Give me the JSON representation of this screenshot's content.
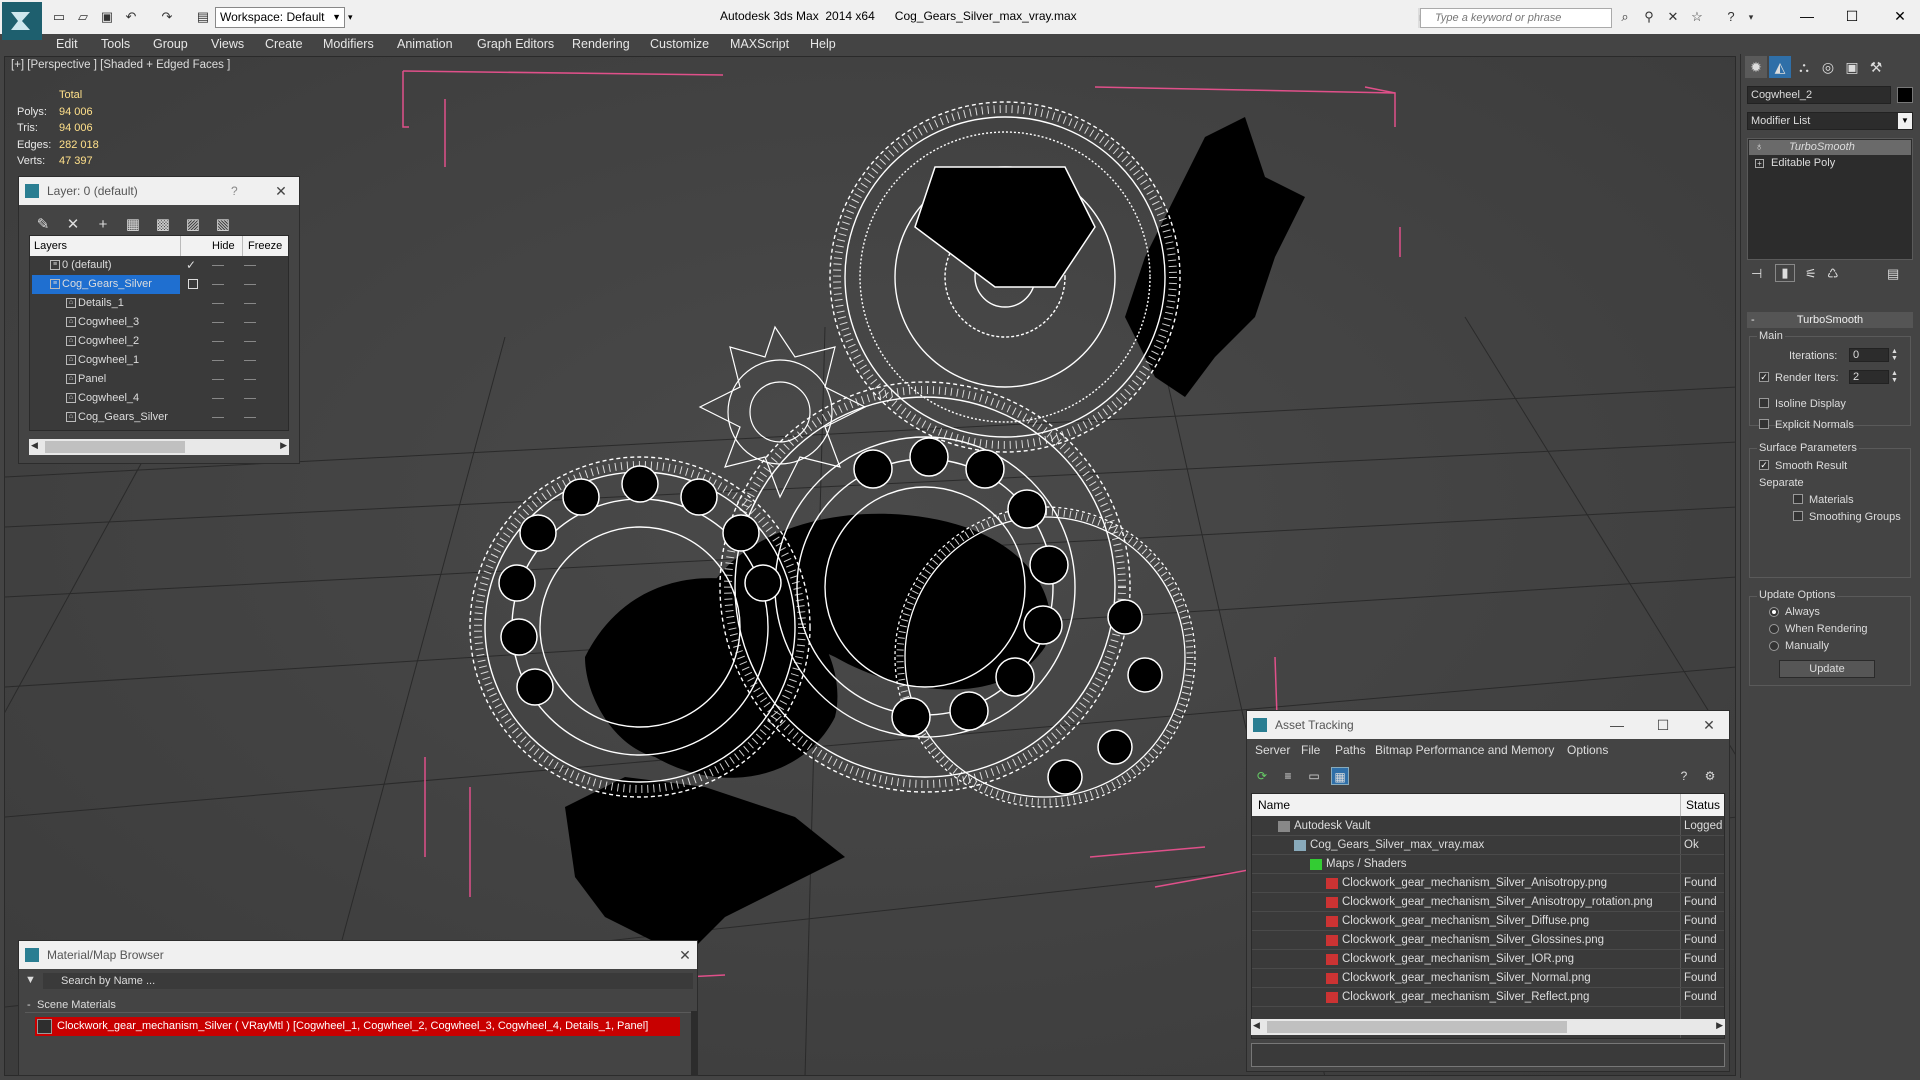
{
  "titlebar": {
    "workspace_label": "Workspace: Default",
    "app_title": "Autodesk 3ds Max  2014 x64",
    "file_title": "Cog_Gears_Silver_max_vray.max",
    "search_placeholder": "Type a keyword or phrase"
  },
  "menu": [
    "Edit",
    "Tools",
    "Group",
    "Views",
    "Create",
    "Modifiers",
    "Animation",
    "Graph Editors",
    "Rendering",
    "Customize",
    "MAXScript",
    "Help"
  ],
  "viewport": {
    "label": "[+] [Perspective ] [Shaded + Edged Faces ]",
    "stats": {
      "header": "Total",
      "rows": [
        {
          "label": "Polys:",
          "value": "94 006"
        },
        {
          "label": "Tris:",
          "value": "94 006"
        },
        {
          "label": "Edges:",
          "value": "282 018"
        },
        {
          "label": "Verts:",
          "value": "47 397"
        }
      ]
    }
  },
  "layer_panel": {
    "title": "Layer: 0 (default)",
    "help": "?",
    "columns": {
      "layers": "Layers",
      "hide": "Hide",
      "freeze": "Freeze"
    },
    "rows": [
      {
        "name": "0 (default)",
        "active": true,
        "selected": false,
        "indent": 1
      },
      {
        "name": "Cog_Gears_Silver",
        "active": false,
        "selected": true,
        "indent": 1
      },
      {
        "name": "Details_1",
        "active": false,
        "selected": false,
        "indent": 2
      },
      {
        "name": "Cogwheel_3",
        "active": false,
        "selected": false,
        "indent": 2
      },
      {
        "name": "Cogwheel_2",
        "active": false,
        "selected": false,
        "indent": 2
      },
      {
        "name": "Cogwheel_1",
        "active": false,
        "selected": false,
        "indent": 2
      },
      {
        "name": "Panel",
        "active": false,
        "selected": false,
        "indent": 2
      },
      {
        "name": "Cogwheel_4",
        "active": false,
        "selected": false,
        "indent": 2
      },
      {
        "name": "Cog_Gears_Silver",
        "active": false,
        "selected": false,
        "indent": 2
      }
    ]
  },
  "command_panel": {
    "object_name": "Cogwheel_2",
    "modifier_list": "Modifier List",
    "stack": [
      "TurboSmooth",
      "Editable Poly"
    ],
    "rollout_title": "TurboSmooth",
    "main_group": "Main",
    "iterations_label": "Iterations:",
    "iterations_value": "0",
    "render_iters_label": "Render Iters:",
    "render_iters_value": "2",
    "render_iters_checked": true,
    "isoline_label": "Isoline Display",
    "isoline_checked": false,
    "explicit_label": "Explicit Normals",
    "explicit_checked": false,
    "surface_group": "Surface Parameters",
    "smooth_result_label": "Smooth Result",
    "smooth_result_checked": true,
    "separate_label": "Separate",
    "materials_label": "Materials",
    "smoothing_groups_label": "Smoothing Groups",
    "update_group": "Update Options",
    "always_label": "Always",
    "when_rendering_label": "When Rendering",
    "manually_label": "Manually",
    "update_button": "Update"
  },
  "asset_panel": {
    "title": "Asset Tracking",
    "menu": [
      "Server",
      "File",
      "Paths",
      "Bitmap Performance and Memory",
      "Options"
    ],
    "columns": {
      "name": "Name",
      "status": "Status"
    },
    "rows": [
      {
        "name": "Autodesk Vault",
        "status": "Logged",
        "indent": 1,
        "kind": "vault"
      },
      {
        "name": "Cog_Gears_Silver_max_vray.max",
        "status": "Ok",
        "indent": 2,
        "kind": "max"
      },
      {
        "name": "Maps / Shaders",
        "status": "",
        "indent": 3,
        "kind": "folder"
      },
      {
        "name": "Clockwork_gear_mechanism_Silver_Anisotropy.png",
        "status": "Found",
        "indent": 4,
        "kind": "png"
      },
      {
        "name": "Clockwork_gear_mechanism_Silver_Anisotropy_rotation.png",
        "status": "Found",
        "indent": 4,
        "kind": "png"
      },
      {
        "name": "Clockwork_gear_mechanism_Silver_Diffuse.png",
        "status": "Found",
        "indent": 4,
        "kind": "png"
      },
      {
        "name": "Clockwork_gear_mechanism_Silver_Glossines.png",
        "status": "Found",
        "indent": 4,
        "kind": "png"
      },
      {
        "name": "Clockwork_gear_mechanism_Silver_IOR.png",
        "status": "Found",
        "indent": 4,
        "kind": "png"
      },
      {
        "name": "Clockwork_gear_mechanism_Silver_Normal.png",
        "status": "Found",
        "indent": 4,
        "kind": "png"
      },
      {
        "name": "Clockwork_gear_mechanism_Silver_Reflect.png",
        "status": "Found",
        "indent": 4,
        "kind": "png"
      }
    ]
  },
  "material_panel": {
    "title": "Material/Map Browser",
    "search_placeholder": "Search by Name ...",
    "group_label": "Scene Materials",
    "item_label": "Clockwork_gear_mechanism_Silver  ( VRayMtl )  [Cogwheel_1, Cogwheel_2, Cogwheel_3, Cogwheel_4, Details_1, Panel]"
  },
  "colors": {
    "selection_blue": "#1f6fd0",
    "material_highlight": "#c80000",
    "stats_yellow": "#ffe08a",
    "wire_white": "#ffffff",
    "gizmo_pink": "#e0508a"
  }
}
